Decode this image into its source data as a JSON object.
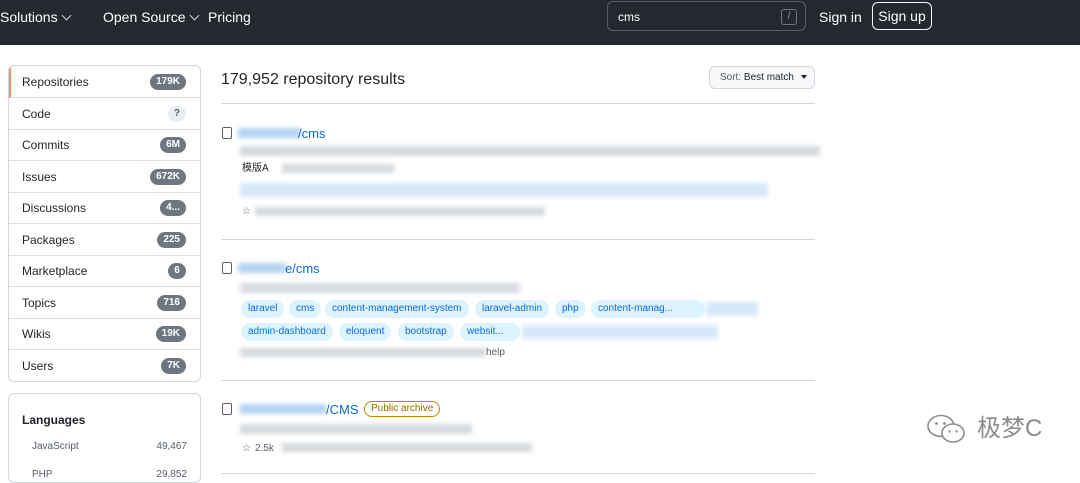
{
  "header": {
    "nav": [
      {
        "label": "Solutions",
        "has_dropdown": true
      },
      {
        "label": "Open Source",
        "has_dropdown": true
      },
      {
        "label": "Pricing",
        "has_dropdown": false
      }
    ],
    "search": {
      "value": "cms",
      "shortcut_key": "/"
    },
    "signin_label": "Sign in",
    "signup_label": "Sign up",
    "colors": {
      "background": "#24292f",
      "text": "#ffffff"
    }
  },
  "sidebar": {
    "filters": [
      {
        "label": "Repositories",
        "count": "179K",
        "selected": true
      },
      {
        "label": "Code",
        "count": "?",
        "selected": false
      },
      {
        "label": "Commits",
        "count": "6M",
        "selected": false
      },
      {
        "label": "Issues",
        "count": "672K",
        "selected": false
      },
      {
        "label": "Discussions",
        "count": "4...",
        "selected": false
      },
      {
        "label": "Packages",
        "count": "225",
        "selected": false
      },
      {
        "label": "Marketplace",
        "count": "6",
        "selected": false
      },
      {
        "label": "Topics",
        "count": "716",
        "selected": false
      },
      {
        "label": "Wikis",
        "count": "19K",
        "selected": false
      },
      {
        "label": "Users",
        "count": "7K",
        "selected": false
      }
    ],
    "languages": {
      "title": "Languages",
      "items": [
        {
          "name": "JavaScript",
          "count": "49,467"
        },
        {
          "name": "PHP",
          "count": "29,852"
        }
      ]
    },
    "accent_color": "#fd8c73"
  },
  "results": {
    "title": "179,952 repository results",
    "sort": {
      "label": "Sort:",
      "value": "Best match"
    },
    "items": [
      {
        "name_suffix": "/cms",
        "description_fragment": "模版A",
        "topics": []
      },
      {
        "name_suffix": "e/cms",
        "topics": [
          "laravel",
          "cms",
          "content-management-system",
          "laravel-admin",
          "php",
          "content-manag...",
          "admin-dashboard",
          "eloquent",
          "bootstrap",
          "websit..."
        ],
        "meta_fragment": "help"
      },
      {
        "name_suffix": "/CMS",
        "badge": "Public archive",
        "meta_fragment": "2.5k"
      }
    ],
    "link_color": "#0969da"
  },
  "watermark": {
    "text": "极梦C",
    "icon": "wechat-icon"
  }
}
